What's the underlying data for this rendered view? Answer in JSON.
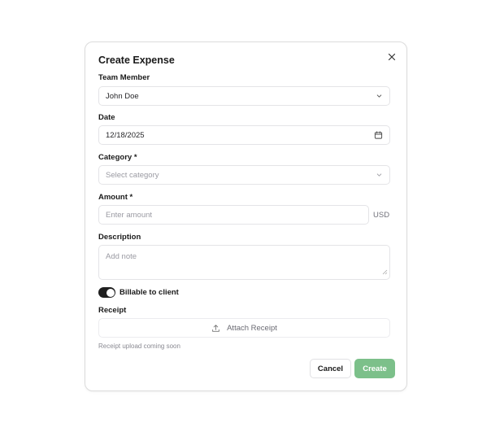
{
  "dialog": {
    "title": "Create Expense",
    "close_icon": "close-icon"
  },
  "team_member": {
    "label": "Team Member",
    "value": "John Doe",
    "icon": "chevron-down-icon"
  },
  "date": {
    "label": "Date",
    "value": "12/18/2025",
    "icon": "calendar-icon"
  },
  "category": {
    "label": "Category *",
    "placeholder": "Select category",
    "icon": "chevron-down-icon"
  },
  "amount": {
    "label": "Amount *",
    "placeholder": "Enter amount",
    "currency": "USD"
  },
  "description": {
    "label": "Description",
    "placeholder": "Add note"
  },
  "billable": {
    "label": "Billable to client",
    "checked": true
  },
  "receipt": {
    "label": "Receipt",
    "button_label": "Attach Receipt",
    "icon": "upload-icon",
    "hint": "Receipt upload coming soon"
  },
  "actions": {
    "cancel_label": "Cancel",
    "create_label": "Create"
  },
  "colors": {
    "primary_disabled": "#7cc08a",
    "toggle_on": "#1f1f1f",
    "border": "#e4e4e7"
  }
}
